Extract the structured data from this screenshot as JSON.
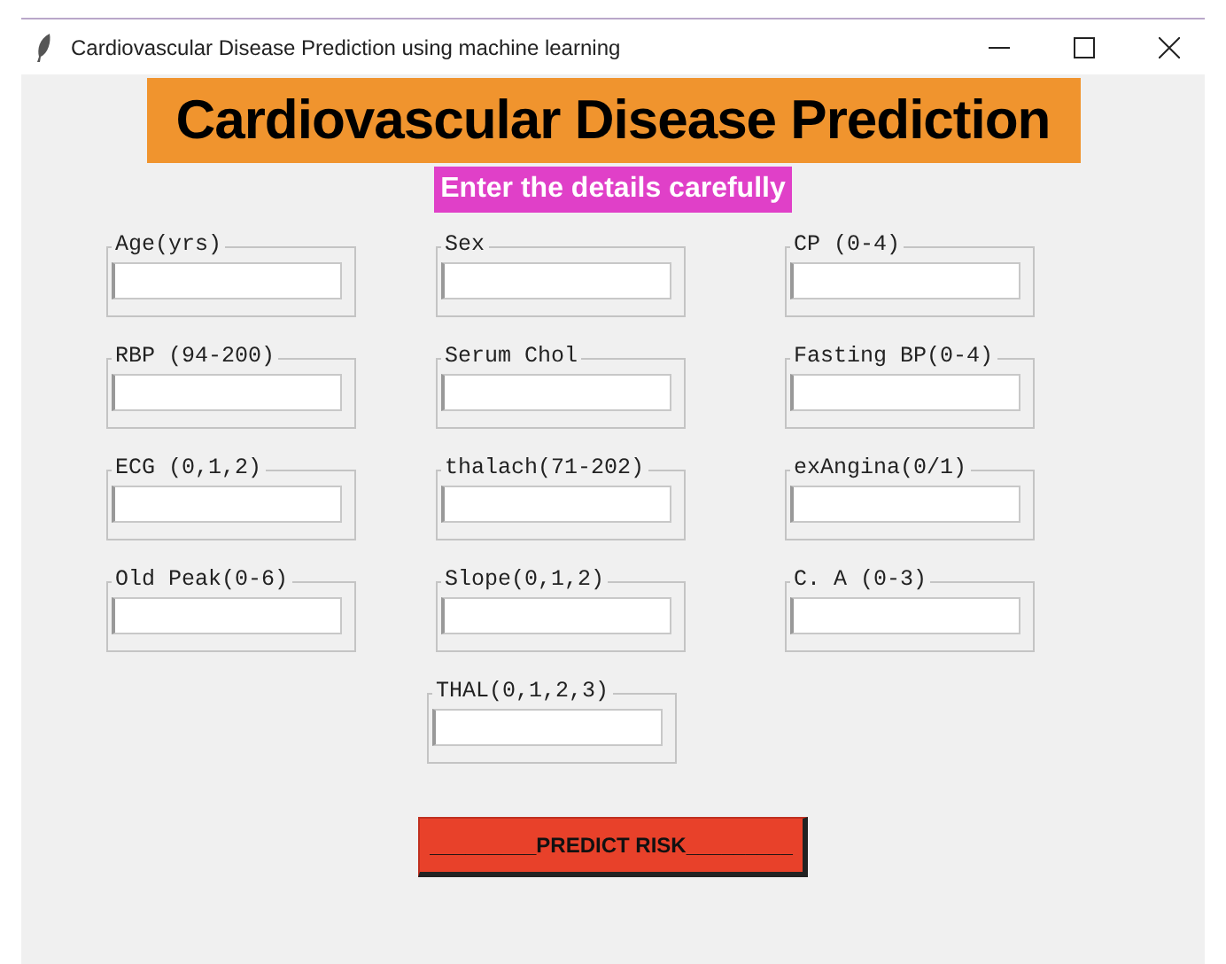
{
  "window": {
    "title": "Cardiovascular Disease Prediction using machine learning"
  },
  "header": {
    "title": "Cardiovascular Disease Prediction",
    "subtitle": "Enter the details carefully"
  },
  "form_rows": [
    [
      {
        "label": "Age(yrs)"
      },
      {
        "label": "Sex"
      },
      {
        "label": "CP (0-4)"
      }
    ],
    [
      {
        "label": "RBP (94-200)"
      },
      {
        "label": "Serum Chol"
      },
      {
        "label": "Fasting BP(0-4)"
      }
    ],
    [
      {
        "label": "ECG (0,1,2)"
      },
      {
        "label": "thalach(71-202)"
      },
      {
        "label": "exAngina(0/1)"
      }
    ],
    [
      {
        "label": "Old Peak(0-6)"
      },
      {
        "label": "Slope(0,1,2)"
      },
      {
        "label": "C. A (0-3)"
      }
    ],
    [
      {
        "label": "THAL(0,1,2,3)"
      }
    ]
  ],
  "button": {
    "label": "_________PREDICT RISK_________"
  }
}
